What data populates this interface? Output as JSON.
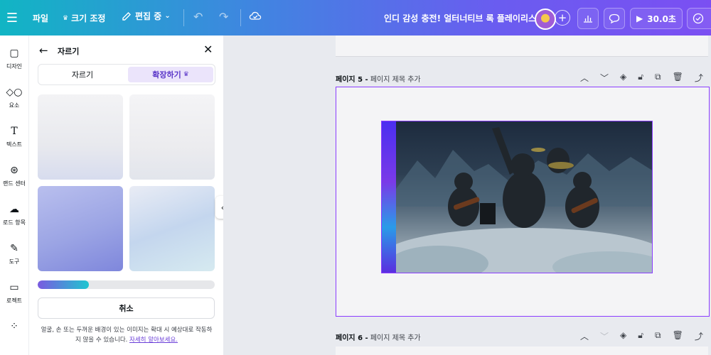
{
  "topbar": {
    "file_label": "파일",
    "resize_label": "크기 조정",
    "edit_label": "편집 중",
    "doc_title": "인디 감성 충전! 얼터너티브 록 플레이리스트",
    "present_label": "30.0초"
  },
  "rail": {
    "items": [
      {
        "label": "디자인",
        "icon": "design-icon"
      },
      {
        "label": "요소",
        "icon": "elements-icon"
      },
      {
        "label": "텍스트",
        "icon": "text-icon"
      },
      {
        "label": "랜드 센터",
        "icon": "brand-icon"
      },
      {
        "label": "로드 항목",
        "icon": "upload-icon"
      },
      {
        "label": "도구",
        "icon": "tools-icon"
      },
      {
        "label": "로젝트",
        "icon": "folder-icon"
      }
    ]
  },
  "panel": {
    "title": "자르기",
    "tab_crop": "자르기",
    "tab_expand": "확장하기",
    "progress": 0.29,
    "cancel_label": "취소",
    "note_text": "얼굴, 손 또는 두꺼운 배경이 있는 이미지는 확대 시 예상대로 작동하지 않을 수 있습니다.",
    "note_link": "자세히 알아보세요."
  },
  "canvas": {
    "page5_number": "페이지 5 -",
    "page5_title": "페이지 제목 추가",
    "page6_number": "페이지 6 -",
    "page6_title": "페이지 제목 추가"
  },
  "colors": {
    "accent": "#8b3dff",
    "topbar_start": "#11b5c4",
    "topbar_end": "#7b4ff2"
  }
}
